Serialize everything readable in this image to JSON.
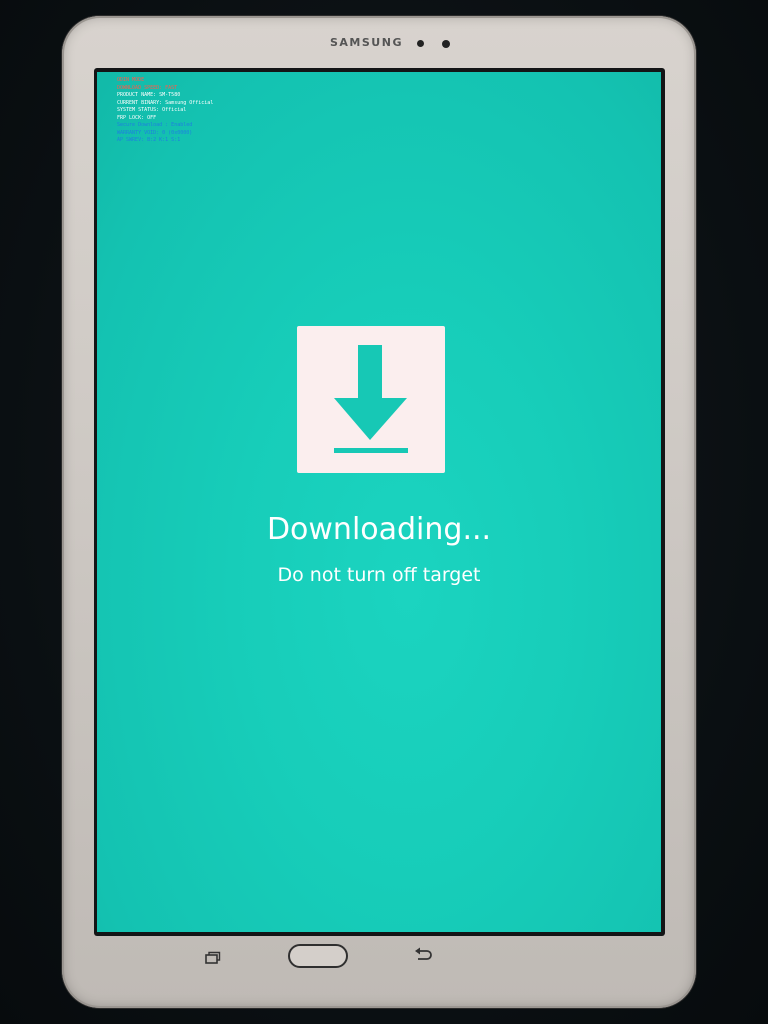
{
  "device": {
    "brand": "SAMSUNG"
  },
  "download_mode": {
    "title": "Downloading...",
    "subtitle": "Do not turn off target",
    "icon": "download-arrow-icon",
    "background_color": "#17cdb9",
    "info_lines": [
      {
        "text": "ODIN MODE",
        "color": "#ff5a4a"
      },
      {
        "text": "DOWNLOAD SPEED: FAST",
        "color": "#ff5a4a"
      },
      {
        "text": "PRODUCT NAME: SM-T580",
        "color": "#ffffff"
      },
      {
        "text": "CURRENT BINARY: Samsung Official",
        "color": "#ffffff"
      },
      {
        "text": "SYSTEM STATUS: Official",
        "color": "#ffffff"
      },
      {
        "text": "FRP LOCK: OFF",
        "color": "#ffffff"
      },
      {
        "text": "Secure Download : Enabled",
        "color": "#1f7fe0"
      },
      {
        "text": "WARRANTY VOID: 0 (0x0000)",
        "color": "#1f7fe0"
      },
      {
        "text": "AP SWREV: B:2 K:1 S:1",
        "color": "#1f7fe0"
      }
    ]
  },
  "nav_keys": {
    "recent": "recent-apps-icon",
    "home": "home-button",
    "back": "back-icon"
  }
}
